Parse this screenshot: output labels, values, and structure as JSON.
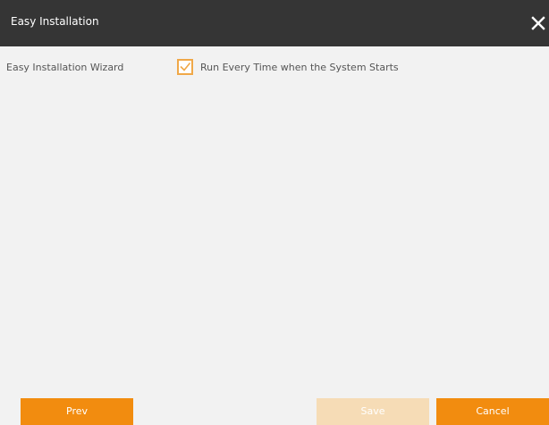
{
  "window": {
    "title": "Easy Installation",
    "close_icon": "close-icon"
  },
  "settings": {
    "wizard_label": "Easy Installation Wizard",
    "run_every_time": {
      "label": "Run Every Time when the System Starts",
      "checked": true
    }
  },
  "footer": {
    "prev_label": "Prev",
    "save_label": "Save",
    "cancel_label": "Cancel",
    "save_enabled": false
  },
  "colors": {
    "titlebar": "#353535",
    "accent": "#f28c0f",
    "accent_disabled": "#f6dcb6",
    "checkbox_border": "#f0a848",
    "background": "#f2f2f2"
  }
}
